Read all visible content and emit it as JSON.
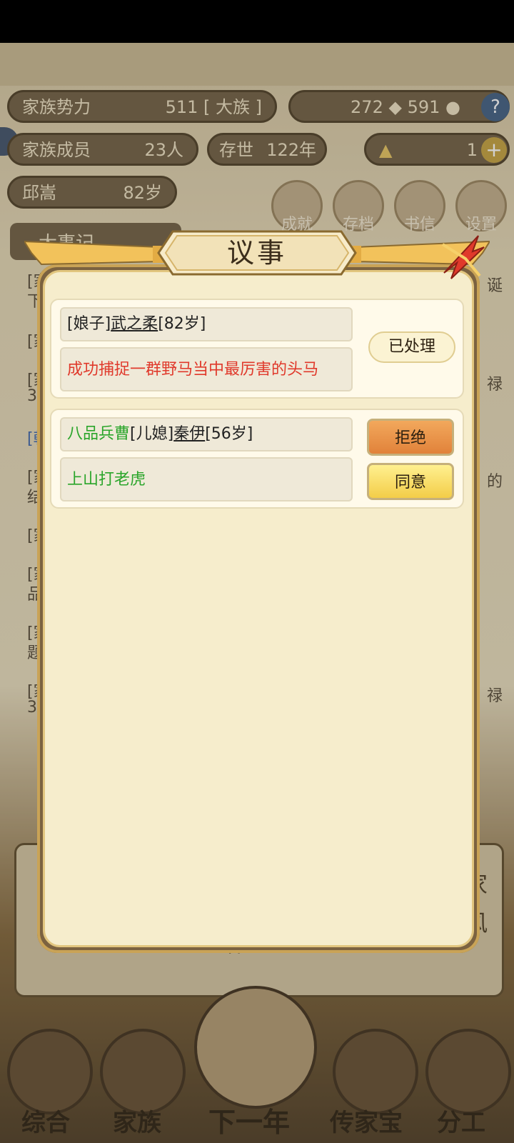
{
  "background": {
    "clan_power_label": "家族势力",
    "clan_power_value": "511",
    "clan_power_rank": "[ 大族 ]",
    "resource_value": "272",
    "coin_value": "591",
    "help_label": "?",
    "members_label": "家族成员",
    "members_value": "23人",
    "alive_label": "存世",
    "alive_value": "122年",
    "gold_value": "1",
    "leader_name": "邱嵩",
    "leader_age": "82岁",
    "menu": [
      "成就",
      "存档",
      "书信",
      "设置"
    ],
    "log_tab": "大事记",
    "log_fragments": [
      "[家",
      "下",
      "[家",
      "[家",
      "3",
      "[朝",
      "[家",
      "结",
      "[家",
      "[家",
      "品",
      "[家",
      "题",
      "[家",
      "3"
    ],
    "right_fragments": [
      "诞",
      "禄",
      "的",
      "禄"
    ],
    "mid_fragments": [
      "家",
      "风",
      "语"
    ]
  },
  "bottom_nav": [
    "综合",
    "家族",
    "下一年",
    "传家宝",
    "分工"
  ],
  "dialog": {
    "title": "议事",
    "items": [
      {
        "role_prefix": "[娘子]",
        "role_name": "武之柔",
        "role_age": "[82岁]",
        "event": "成功捕捉一群野马当中最厉害的头马",
        "status_button": "已处理"
      },
      {
        "title_prefix": "八品兵曹",
        "role_prefix": "[儿媳]",
        "role_name": "秦伊",
        "role_age": "[56岁]",
        "event": "上山打老虎",
        "reject_button": "拒绝",
        "agree_button": "同意"
      }
    ]
  },
  "colors": {
    "accent_gold": "#e2c67f",
    "panel_bg": "#f6edcc",
    "event_red": "#e0392b",
    "event_green": "#2aa52a",
    "reject_orange": "#e1823a",
    "agree_yellow": "#f3cd48"
  }
}
